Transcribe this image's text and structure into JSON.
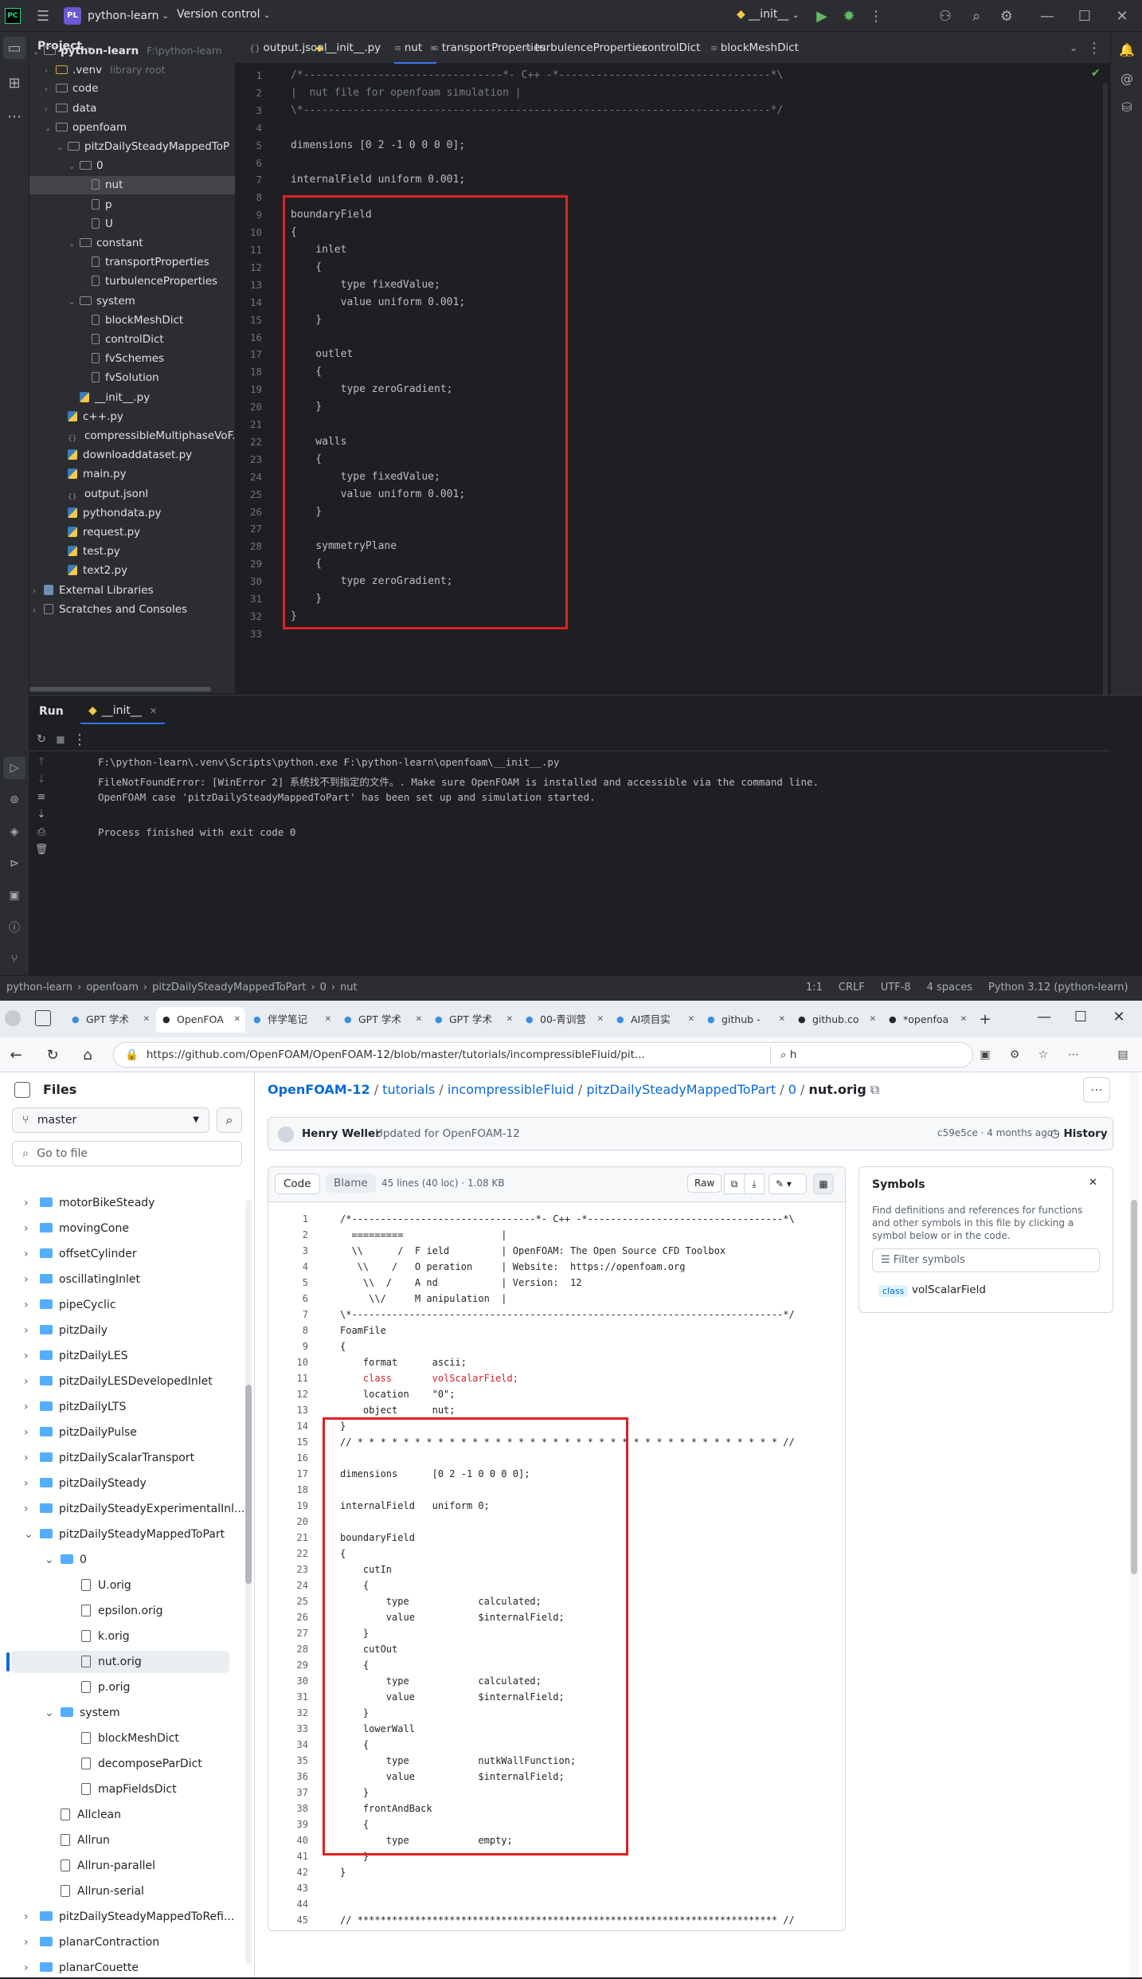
{
  "ide": {
    "project_initials": "PL",
    "project_name": "python-learn",
    "vcs": "Version control",
    "run_config": "__init__",
    "project_panel_title": "Project",
    "tree": [
      {
        "label": "python-learn",
        "hint": "F:\\python-learn",
        "depth": 0,
        "kind": "folder",
        "open": true,
        "bold": true
      },
      {
        "label": ".venv",
        "hint": "library root",
        "depth": 1,
        "kind": "folder-o",
        "open": false
      },
      {
        "label": "code",
        "depth": 1,
        "kind": "folder",
        "open": false
      },
      {
        "label": "data",
        "depth": 1,
        "kind": "folder",
        "open": false
      },
      {
        "label": "openfoam",
        "depth": 1,
        "kind": "folder",
        "open": true
      },
      {
        "label": "pitzDailySteadyMappedToP",
        "depth": 2,
        "kind": "folder",
        "open": true
      },
      {
        "label": "0",
        "depth": 3,
        "kind": "folder",
        "open": true
      },
      {
        "label": "nut",
        "depth": 4,
        "kind": "file",
        "selected": true
      },
      {
        "label": "p",
        "depth": 4,
        "kind": "file"
      },
      {
        "label": "U",
        "depth": 4,
        "kind": "file"
      },
      {
        "label": "constant",
        "depth": 3,
        "kind": "folder",
        "open": true
      },
      {
        "label": "transportProperties",
        "depth": 4,
        "kind": "file"
      },
      {
        "label": "turbulenceProperties",
        "depth": 4,
        "kind": "file"
      },
      {
        "label": "system",
        "depth": 3,
        "kind": "folder",
        "open": true
      },
      {
        "label": "blockMeshDict",
        "depth": 4,
        "kind": "file"
      },
      {
        "label": "controlDict",
        "depth": 4,
        "kind": "file"
      },
      {
        "label": "fvSchemes",
        "depth": 4,
        "kind": "file"
      },
      {
        "label": "fvSolution",
        "depth": 4,
        "kind": "file"
      },
      {
        "label": "__init__.py",
        "depth": 3,
        "kind": "py"
      },
      {
        "label": "c++.py",
        "depth": 2,
        "kind": "py"
      },
      {
        "label": "compressibleMultiphaseVoF.jsc",
        "depth": 2,
        "kind": "json"
      },
      {
        "label": "downloaddataset.py",
        "depth": 2,
        "kind": "py"
      },
      {
        "label": "main.py",
        "depth": 2,
        "kind": "py"
      },
      {
        "label": "output.jsonl",
        "depth": 2,
        "kind": "json"
      },
      {
        "label": "pythondata.py",
        "depth": 2,
        "kind": "py"
      },
      {
        "label": "request.py",
        "depth": 2,
        "kind": "py"
      },
      {
        "label": "test.py",
        "depth": 2,
        "kind": "py"
      },
      {
        "label": "text2.py",
        "depth": 2,
        "kind": "py"
      },
      {
        "label": "External Libraries",
        "depth": 0,
        "kind": "lib",
        "open": false
      },
      {
        "label": "Scratches and Consoles",
        "depth": 0,
        "kind": "scratch",
        "open": false
      }
    ],
    "tabs": [
      {
        "label": "output.jsonl",
        "kind": "json"
      },
      {
        "label": "__init__.py",
        "kind": "py"
      },
      {
        "label": "nut",
        "kind": "file",
        "active": true
      },
      {
        "label": "transportProperties",
        "kind": "file"
      },
      {
        "label": "turbulenceProperties",
        "kind": "file"
      },
      {
        "label": "controlDict",
        "kind": "file"
      },
      {
        "label": "blockMeshDict",
        "kind": "file"
      }
    ],
    "code_lines": [
      "/*--------------------------------*- C++ -*----------------------------------*\\",
      "|  nut file for openfoam simulation |",
      "\\*---------------------------------------------------------------------------*/",
      "",
      "dimensions [0 2 -1 0 0 0 0];",
      "",
      "internalField uniform 0.001;",
      "",
      "boundaryField",
      "{",
      "    inlet",
      "    {",
      "        type fixedValue;",
      "        value uniform 0.001;",
      "    }",
      "",
      "    outlet",
      "    {",
      "        type zeroGradient;",
      "    }",
      "",
      "    walls",
      "    {",
      "        type fixedValue;",
      "        value uniform 0.001;",
      "    }",
      "",
      "    symmetryPlane",
      "    {",
      "        type zeroGradient;",
      "    }",
      "}",
      ""
    ],
    "run": {
      "title": "Run",
      "tab": "__init__",
      "output": [
        "F:\\python-learn\\.venv\\Scripts\\python.exe F:\\python-learn\\openfoam\\__init__.py",
        "FileNotFoundError: [WinError 2] 系统找不到指定的文件。. Make sure OpenFOAM is installed and accessible via the command line.",
        "OpenFOAM case 'pitzDailySteadyMappedToPart' has been set up and simulation started.",
        "",
        "Process finished with exit code 0"
      ]
    },
    "status": {
      "breadcrumb": [
        "python-learn",
        "openfoam",
        "pitzDailySteadyMappedToPart",
        "0",
        "nut"
      ],
      "position": "1:1",
      "line_sep": "CRLF",
      "encoding": "UTF-8",
      "indent": "4 spaces",
      "interpreter": "Python 3.12 (python-learn)"
    }
  },
  "browser": {
    "tabs": [
      "GPT 学术",
      "OpenFOA",
      "伴学笔记",
      "GPT 学术",
      "GPT 学术",
      "00-青训营",
      "AI项目实",
      "github -",
      "github.co",
      "*openfoa"
    ],
    "url": "https://github.com/OpenFOAM/OpenFOAM-12/blob/master/tutorials/incompressibleFluid/pit...",
    "search_text": "h",
    "files_title": "Files",
    "branch": "master",
    "goto_placeholder": "Go to file",
    "files": [
      {
        "label": "motorBikeSteady",
        "depth": 0,
        "kind": "folder"
      },
      {
        "label": "movingCone",
        "depth": 0,
        "kind": "folder"
      },
      {
        "label": "offsetCylinder",
        "depth": 0,
        "kind": "folder"
      },
      {
        "label": "oscillatingInlet",
        "depth": 0,
        "kind": "folder"
      },
      {
        "label": "pipeCyclic",
        "depth": 0,
        "kind": "folder"
      },
      {
        "label": "pitzDaily",
        "depth": 0,
        "kind": "folder"
      },
      {
        "label": "pitzDailyLES",
        "depth": 0,
        "kind": "folder"
      },
      {
        "label": "pitzDailyLESDevelopedInlet",
        "depth": 0,
        "kind": "folder"
      },
      {
        "label": "pitzDailyLTS",
        "depth": 0,
        "kind": "folder"
      },
      {
        "label": "pitzDailyPulse",
        "depth": 0,
        "kind": "folder"
      },
      {
        "label": "pitzDailyScalarTransport",
        "depth": 0,
        "kind": "folder"
      },
      {
        "label": "pitzDailySteady",
        "depth": 0,
        "kind": "folder"
      },
      {
        "label": "pitzDailySteadyExperimentalInl...",
        "depth": 0,
        "kind": "folder"
      },
      {
        "label": "pitzDailySteadyMappedToPart",
        "depth": 0,
        "kind": "folder",
        "open": true
      },
      {
        "label": "0",
        "depth": 1,
        "kind": "folder",
        "open": true
      },
      {
        "label": "U.orig",
        "depth": 2,
        "kind": "file"
      },
      {
        "label": "epsilon.orig",
        "depth": 2,
        "kind": "file"
      },
      {
        "label": "k.orig",
        "depth": 2,
        "kind": "file"
      },
      {
        "label": "nut.orig",
        "depth": 2,
        "kind": "file",
        "selected": true
      },
      {
        "label": "p.orig",
        "depth": 2,
        "kind": "file"
      },
      {
        "label": "system",
        "depth": 1,
        "kind": "folder",
        "open": true
      },
      {
        "label": "blockMeshDict",
        "depth": 2,
        "kind": "file"
      },
      {
        "label": "decomposeParDict",
        "depth": 2,
        "kind": "file"
      },
      {
        "label": "mapFieldsDict",
        "depth": 2,
        "kind": "file"
      },
      {
        "label": "Allclean",
        "depth": 1,
        "kind": "file"
      },
      {
        "label": "Allrun",
        "depth": 1,
        "kind": "file"
      },
      {
        "label": "Allrun-parallel",
        "depth": 1,
        "kind": "file"
      },
      {
        "label": "Allrun-serial",
        "depth": 1,
        "kind": "file"
      },
      {
        "label": "pitzDailySteadyMappedToRefi...",
        "depth": 0,
        "kind": "folder"
      },
      {
        "label": "planarContraction",
        "depth": 0,
        "kind": "folder"
      },
      {
        "label": "planarCouette",
        "depth": 0,
        "kind": "folder"
      }
    ],
    "breadcrumb": [
      "OpenFOAM-12",
      "tutorials",
      "incompressibleFluid",
      "pitzDailySteadyMappedToPart",
      "0",
      "nut.orig"
    ],
    "commit": {
      "author": "Henry Weller",
      "message": "Updated for OpenFOAM-12",
      "hash": "c59e5ce · 4 months ago",
      "history": "History"
    },
    "view": {
      "code": "Code",
      "blame": "Blame",
      "info": "45 lines (40 loc) · 1.08 KB",
      "raw": "Raw"
    },
    "symbols": {
      "title": "Symbols",
      "desc": "Find definitions and references for functions and other symbols in this file by clicking a symbol below or in the code.",
      "filter_placeholder": "Filter symbols",
      "badge": "class",
      "name": "volScalarField"
    },
    "code_lines": [
      "/*--------------------------------*- C++ -*----------------------------------*\\",
      "  =========                 |",
      "  \\\\      /  F ield         | OpenFOAM: The Open Source CFD Toolbox",
      "   \\\\    /   O peration     | Website:  https://openfoam.org",
      "    \\\\  /    A nd           | Version:  12",
      "     \\\\/     M anipulation  |",
      "\\*---------------------------------------------------------------------------*/",
      "FoamFile",
      "{",
      "    format      ascii;",
      "    class       volScalarField;",
      "    location    \"0\";",
      "    object      nut;",
      "}",
      "// * * * * * * * * * * * * * * * * * * * * * * * * * * * * * * * * * * * * * //",
      "",
      "dimensions      [0 2 -1 0 0 0 0];",
      "",
      "internalField   uniform 0;",
      "",
      "boundaryField",
      "{",
      "    cutIn",
      "    {",
      "        type            calculated;",
      "        value           $internalField;",
      "    }",
      "    cutOut",
      "    {",
      "        type            calculated;",
      "        value           $internalField;",
      "    }",
      "    lowerWall",
      "    {",
      "        type            nutkWallFunction;",
      "        value           $internalField;",
      "    }",
      "    frontAndBack",
      "    {",
      "        type            empty;",
      "    }",
      "}",
      "",
      "",
      "// ************************************************************************* //"
    ]
  }
}
